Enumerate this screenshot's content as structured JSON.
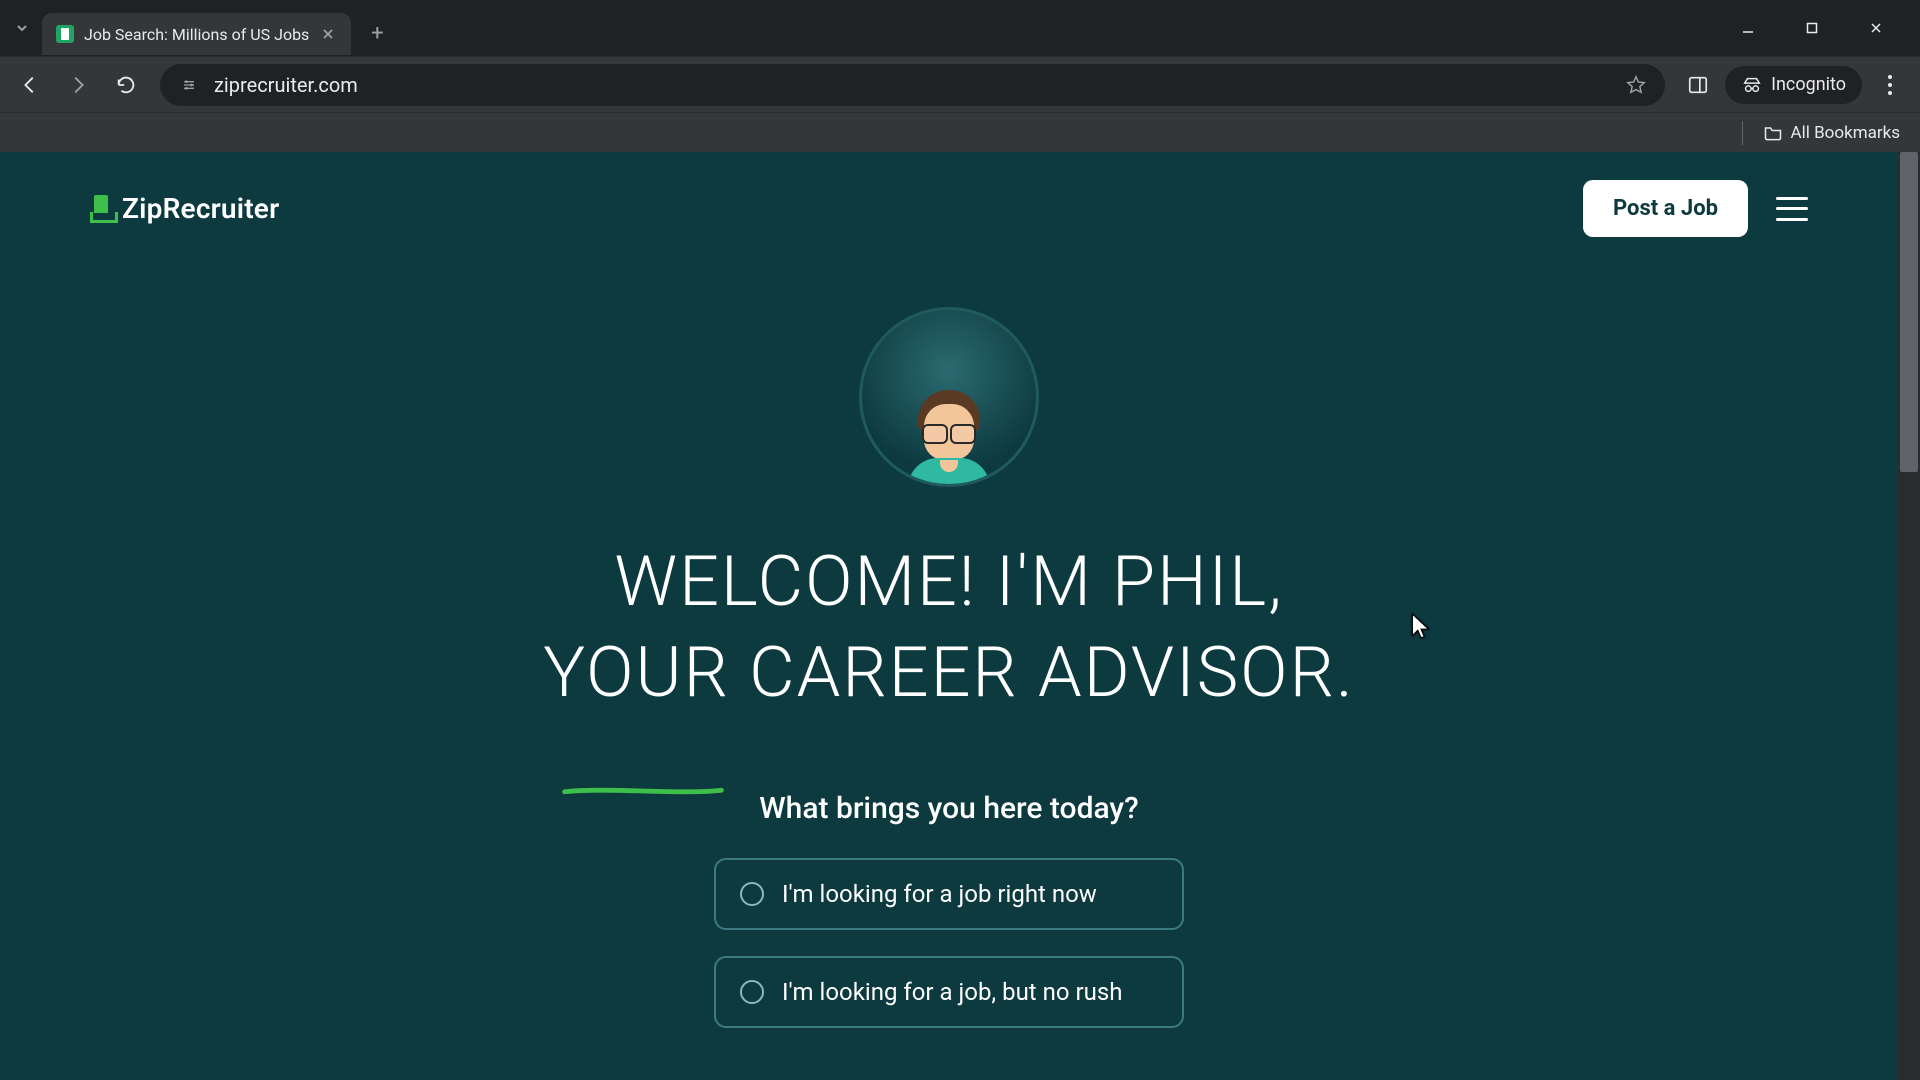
{
  "browser": {
    "tab_title": "Job Search: Millions of US Jobs",
    "url": "ziprecruiter.com",
    "incognito_label": "Incognito",
    "all_bookmarks_label": "All Bookmarks"
  },
  "site": {
    "logo_text": "ZipRecruiter",
    "post_job_label": "Post a Job"
  },
  "hero": {
    "headline_line1": "WELCOME! I'M PHIL,",
    "headline_line2_pre": "YOUR",
    "headline_line2_post": " CAREER ADVISOR.",
    "prompt": "What brings you here today?",
    "options": [
      {
        "label": "I'm looking for a job right now"
      },
      {
        "label": "I'm looking for a job, but no rush"
      }
    ]
  }
}
